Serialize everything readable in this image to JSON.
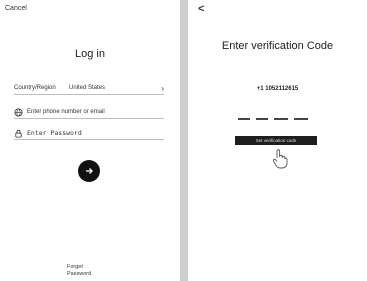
{
  "login": {
    "cancel": "Cancel",
    "title": "Log in",
    "region_label": "Country/Region",
    "region_value": "United States",
    "phone_placeholder": "Enter phone number or email",
    "password_placeholder": "Enter Password",
    "forgot_line1": "Forget",
    "forgot_line2": "Password",
    "submit_icon": "arrow-right-icon"
  },
  "verify": {
    "back": "<",
    "title": "Enter verification Code",
    "phone": "+1 1052112615",
    "tooltip": "Set verification code",
    "code_slots": 4
  }
}
